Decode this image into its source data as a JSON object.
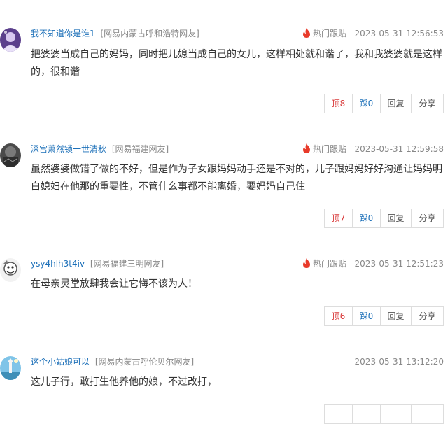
{
  "comments": [
    {
      "user": "我不知道你是谁1",
      "location": "[网易内蒙古呼和浩特网友]",
      "hot_label": "热门跟贴",
      "time": "2023-05-31 12:56:53",
      "text": "把婆婆当成自己的妈妈，同时把儿媳当成自己的女儿，这样相处就和谐了，我和我婆婆就是这样的，很和谐",
      "up": "顶8",
      "down": "踩0",
      "reply": "回复",
      "share": "分享"
    },
    {
      "user": "深宫萧然锁一世清秋",
      "location": "[网易福建网友]",
      "hot_label": "热门跟贴",
      "time": "2023-05-31 12:59:58",
      "text": "虽然婆婆做错了做的不好，但是作为子女跟妈妈动手还是不对的，儿子跟妈妈好好沟通让妈妈明白媳妇在他那的重要性，不管什么事都不能离婚，要妈妈自己住",
      "up": "顶7",
      "down": "踩0",
      "reply": "回复",
      "share": "分享"
    },
    {
      "user": "ysy4hlh3t4iv",
      "location": "[网易福建三明网友]",
      "hot_label": "热门跟贴",
      "time": "2023-05-31 12:51:23",
      "text": "在母亲灵堂放肆我会让它悔不该为人！",
      "up": "顶6",
      "down": "踩0",
      "reply": "回复",
      "share": "分享"
    },
    {
      "user": "这个小姑娘可以",
      "location": "[网易内蒙古呼伦贝尔网友]",
      "time": "2023-05-31 13:12:20",
      "text": "这儿子行，敢打生他养他的娘，不过改打，"
    }
  ],
  "colors": {
    "username": "#1b6fb8",
    "meta": "#888888",
    "up": "#d93a3a",
    "down": "#1b6fb8",
    "hot_icon": "#e83a2a"
  },
  "icons": {
    "hot": "flame-icon"
  }
}
